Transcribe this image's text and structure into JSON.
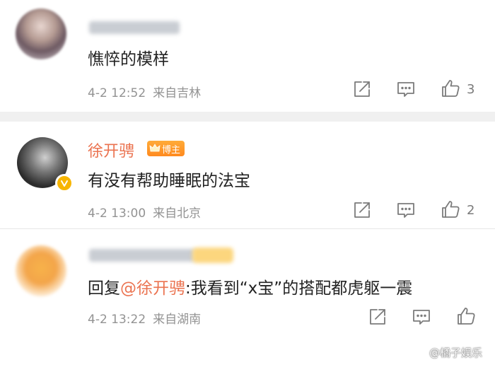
{
  "comments": [
    {
      "text": "憔悴的模样",
      "time": "4-2 12:52",
      "location": "来自吉林",
      "likes": "3"
    },
    {
      "name": "徐开骋",
      "badge": "博主",
      "text": "有没有帮助睡眠的法宝",
      "time": "4-2 13:00",
      "location": "来自北京",
      "likes": "2"
    },
    {
      "reply_prefix": "回复",
      "mention": "@徐开骋",
      "text": ":我看到“x宝”的搭配都虎躯一震",
      "time": "4-2 13:22",
      "location": "来自湖南"
    }
  ],
  "watermark": "@橘子娱乐",
  "colors": {
    "accent": "#eb7350",
    "meta": "#939393",
    "icon": "#7b7b7b",
    "verified": "#f7b500"
  },
  "icons": [
    "share-icon",
    "comment-icon",
    "like-icon",
    "verified-icon",
    "crown-icon",
    "weibo-logo-icon"
  ]
}
